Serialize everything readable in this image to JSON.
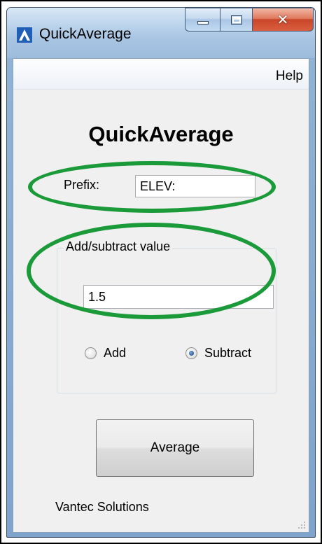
{
  "window": {
    "title": "QuickAverage",
    "icon": "app-logo-icon",
    "caption_buttons": [
      "minimize-icon",
      "maximize-icon",
      "close-icon"
    ]
  },
  "menu": {
    "items": [
      "Help"
    ]
  },
  "form": {
    "heading": "QuickAverage",
    "prefix_label": "Prefix:",
    "prefix_value": "ELEV:",
    "group_title": "Add/subtract value",
    "value": "1.5",
    "radio_add_label": "Add",
    "radio_subtract_label": "Subtract",
    "selected_option": "Subtract",
    "button_label": "Average",
    "footer": "Vantec Solutions"
  },
  "annotations": {
    "highlight_color": "#1b9a3a"
  }
}
